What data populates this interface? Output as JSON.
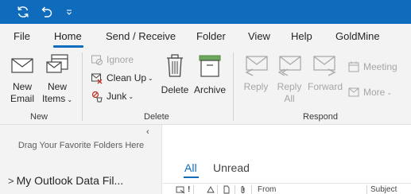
{
  "qat": {
    "sync_icon": "sync-icon",
    "undo_icon": "undo-icon",
    "customize_icon": "chevron-down-icon"
  },
  "tabs": [
    {
      "label": "File"
    },
    {
      "label": "Home",
      "active": true
    },
    {
      "label": "Send / Receive"
    },
    {
      "label": "Folder"
    },
    {
      "label": "View"
    },
    {
      "label": "Help"
    },
    {
      "label": "GoldMine"
    }
  ],
  "ribbon": {
    "new_group": {
      "label": "New",
      "new_email": {
        "line1": "New",
        "line2": "Email"
      },
      "new_items": {
        "line1": "New",
        "line2": "Items"
      }
    },
    "delete_group": {
      "label": "Delete",
      "ignore": "Ignore",
      "clean_up": "Clean Up",
      "junk": "Junk",
      "delete": "Delete",
      "archive": "Archive"
    },
    "respond_group": {
      "label": "Respond",
      "reply": "Reply",
      "reply_all": {
        "line1": "Reply",
        "line2": "All"
      },
      "forward": "Forward",
      "meeting": "Meeting",
      "more": "More"
    }
  },
  "nav": {
    "drag_hint": "Drag Your Favorite Folders Here",
    "folder": "My Outlook Data Fil..."
  },
  "list": {
    "tabs": [
      "All",
      "Unread"
    ],
    "columns": {
      "importance": "!",
      "from": "From",
      "subject": "Subject"
    }
  },
  "colors": {
    "accent": "#0f6cbd",
    "ribbon_bg": "#f3f3f3",
    "disabled": "#a6a6a6",
    "junk_red": "#c42b1c",
    "archive_green": "#4a8a3a"
  }
}
